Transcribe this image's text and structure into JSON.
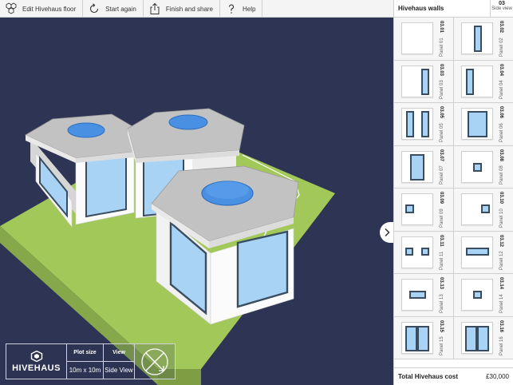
{
  "toolbar": {
    "edit_floor": "Edit Hivehaus floor",
    "start_again": "Start again",
    "finish_share": "Finish and share",
    "help": "Help"
  },
  "info": {
    "brand": "HIVEHAUS",
    "plot_size_label": "Plot size",
    "plot_size_value": "10m x 10m",
    "view_label": "View",
    "view_value": "Side View"
  },
  "sidebar": {
    "title": "Hivehaus walls",
    "side_code": "03",
    "side_label": "Side view",
    "total_label": "Total Hivehaus cost",
    "total_value": "£30,000",
    "panels": [
      {
        "code": "03.01",
        "name": "Panel 01"
      },
      {
        "code": "03.02",
        "name": "Panel 02"
      },
      {
        "code": "03.03",
        "name": "Panel 03"
      },
      {
        "code": "03.04",
        "name": "Panel 04"
      },
      {
        "code": "03.05",
        "name": "Panel 05"
      },
      {
        "code": "03.06",
        "name": "Panel 06"
      },
      {
        "code": "03.07",
        "name": "Panel 07"
      },
      {
        "code": "03.08",
        "name": "Panel 08"
      },
      {
        "code": "03.09",
        "name": "Panel 09"
      },
      {
        "code": "03.10",
        "name": "Panel 10"
      },
      {
        "code": "03.11",
        "name": "Panel 11"
      },
      {
        "code": "03.12",
        "name": "Panel 12"
      },
      {
        "code": "03.13",
        "name": "Panel 13"
      },
      {
        "code": "03.14",
        "name": "Panel 14"
      },
      {
        "code": "03.15",
        "name": "Panel 15"
      },
      {
        "code": "03.16",
        "name": "Panel 16"
      }
    ]
  },
  "colors": {
    "background": "#2e3453",
    "ground": "#a3c85a",
    "glass": "#a9d3f5",
    "roof": "#bdbdbd",
    "skylight": "#4a90e2"
  }
}
